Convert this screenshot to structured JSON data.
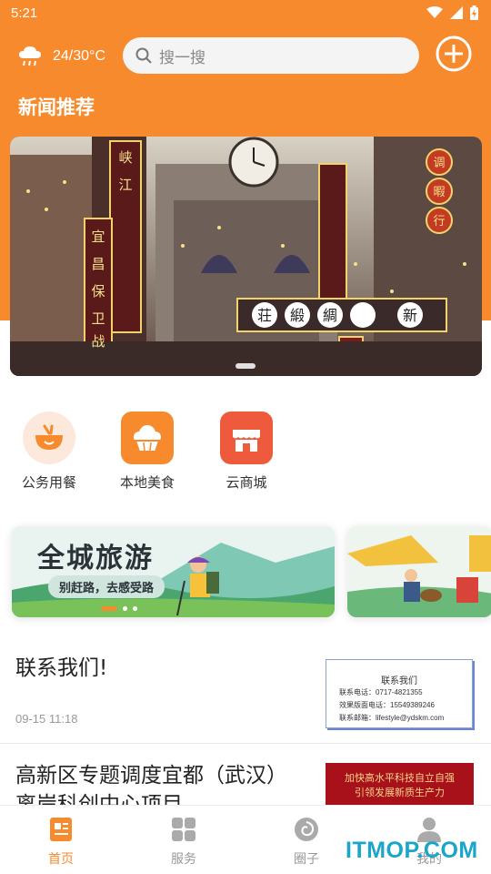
{
  "statusbar": {
    "time": "5:21"
  },
  "header": {
    "weather_temp": "24/30°C",
    "weather_icon": "cloud-rain-icon",
    "search_placeholder": "搜一搜",
    "section_title": "新闻推荐"
  },
  "banner": {
    "signs": [
      "峡",
      "江",
      "宜",
      "昌",
      "保",
      "卫",
      "战",
      "荘",
      "緞",
      "綢",
      "新",
      "调",
      "暇",
      "行"
    ]
  },
  "quick_links": [
    {
      "label": "公务用餐",
      "icon": "bowl-icon"
    },
    {
      "label": "本地美食",
      "icon": "cake-icon"
    },
    {
      "label": "云商城",
      "icon": "shop-icon"
    }
  ],
  "promo": {
    "card1_title": "全城旅游",
    "card1_sub": "别赶路，去感受路"
  },
  "articles": [
    {
      "title": "联系我们!",
      "time": "09-15 11:18",
      "thumb_title": "联系我们",
      "thumb_lines": [
        "联系电话：0717-4821355",
        "效果版面电话：15549389246",
        "联系邮箱：lifestyle@ydskm.com"
      ]
    },
    {
      "title": "高新区专题调度宜都（武汉）离岸科创中心项目",
      "thumb_lines": [
        "加快高水平科技自立自强",
        "引领发展新质生产力"
      ]
    }
  ],
  "tabs": [
    {
      "label": "首页",
      "icon": "home-doc-icon",
      "active": true
    },
    {
      "label": "服务",
      "icon": "grid-icon",
      "active": false
    },
    {
      "label": "圈子",
      "icon": "circle-swirl-icon",
      "active": false
    },
    {
      "label": "我的",
      "icon": "user-icon",
      "active": false
    }
  ],
  "watermark": "ITMOP.COM",
  "colors": {
    "accent": "#f78a2d",
    "watermark": "#1aa6c9"
  }
}
